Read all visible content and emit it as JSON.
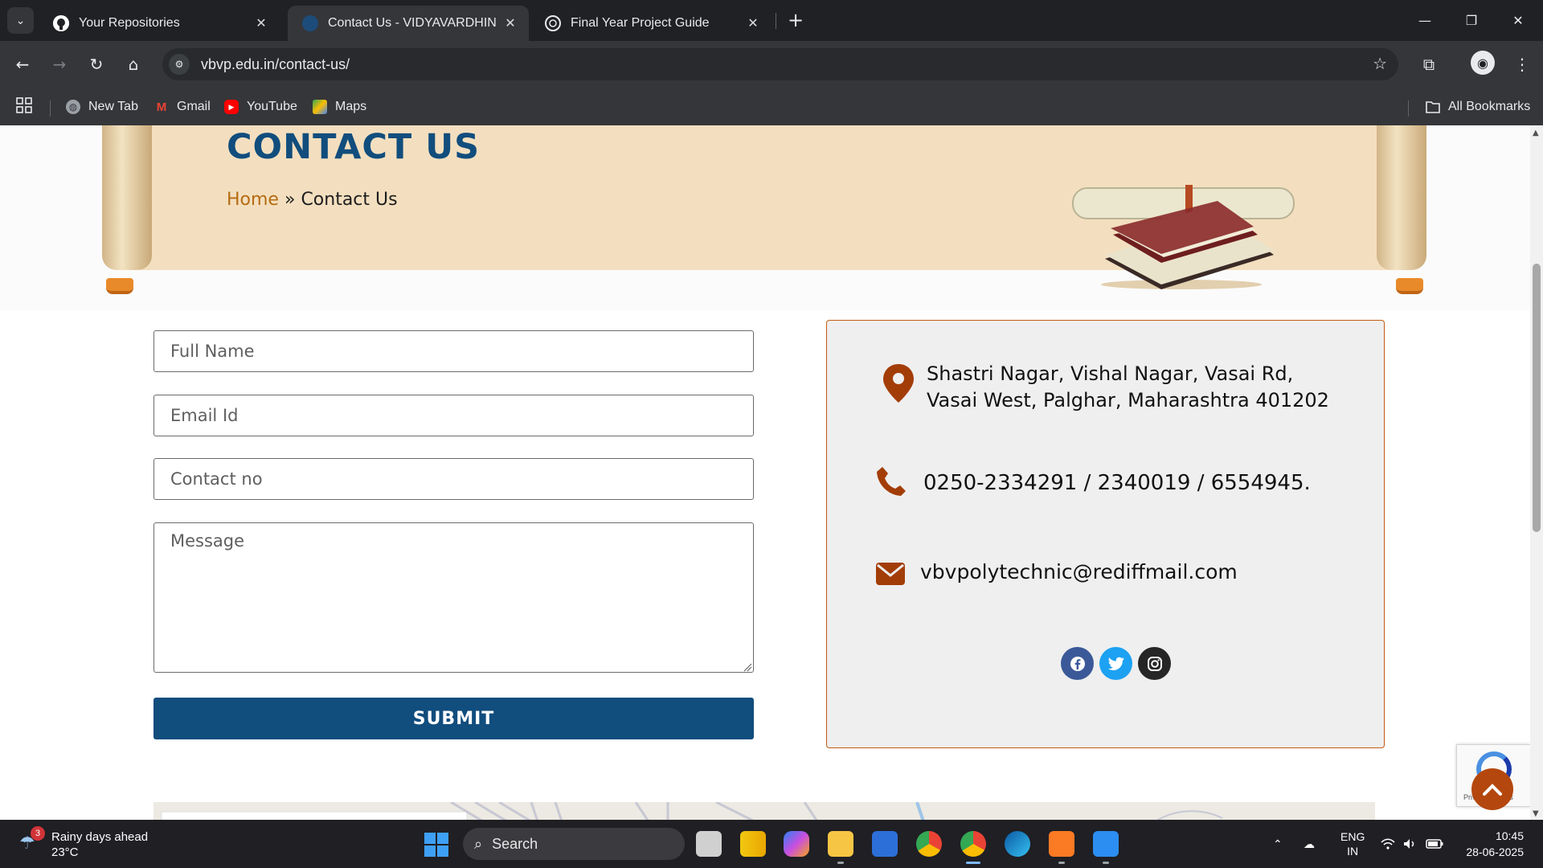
{
  "browser": {
    "tabs": [
      {
        "title": "Your Repositories",
        "active": false,
        "icon": "github-icon"
      },
      {
        "title": "Contact Us - VIDYAVARDHINI'S",
        "active": true,
        "icon": "site-favicon"
      },
      {
        "title": "Final Year Project Guide",
        "active": false,
        "icon": "openai-icon"
      }
    ],
    "url": "vbvp.edu.in/contact-us/",
    "bookmarks": [
      {
        "label": "New Tab",
        "icon": "globe-icon"
      },
      {
        "label": "Gmail",
        "icon": "gmail-icon"
      },
      {
        "label": "YouTube",
        "icon": "youtube-icon"
      },
      {
        "label": "Maps",
        "icon": "maps-icon"
      }
    ],
    "all_bookmarks": "All Bookmarks"
  },
  "page": {
    "title": "CONTACT US",
    "breadcrumb": {
      "home": "Home",
      "separator": "»",
      "current": "Contact Us"
    },
    "form": {
      "full_name_placeholder": "Full Name",
      "email_placeholder": "Email Id",
      "contact_placeholder": "Contact no",
      "message_placeholder": "Message",
      "submit_label": "SUBMIT"
    },
    "contact": {
      "address_line1": "Shastri Nagar, Vishal Nagar, Vasai Rd,",
      "address_line2": "Vasai West, Palghar, Maharashtra 401202",
      "phone": "0250-2334291 / 2340019 / 6554945.",
      "email": "vbvpolytechnic@rediffmail.com"
    },
    "social": [
      "facebook-icon",
      "twitter-icon",
      "instagram-icon"
    ],
    "recaptcha_text": "Privacy - Terms",
    "colors": {
      "primary": "#114d7d",
      "accent": "#b4470e",
      "breadcrumb_home": "#b56b12",
      "banner": "#f3dfbf"
    }
  },
  "taskbar": {
    "weather_title": "Rainy days ahead",
    "weather_temp": "23°C",
    "weather_badge": "3",
    "search_label": "Search",
    "lang_line1": "ENG",
    "lang_line2": "IN",
    "time": "10:45",
    "date": "28-06-2025"
  }
}
